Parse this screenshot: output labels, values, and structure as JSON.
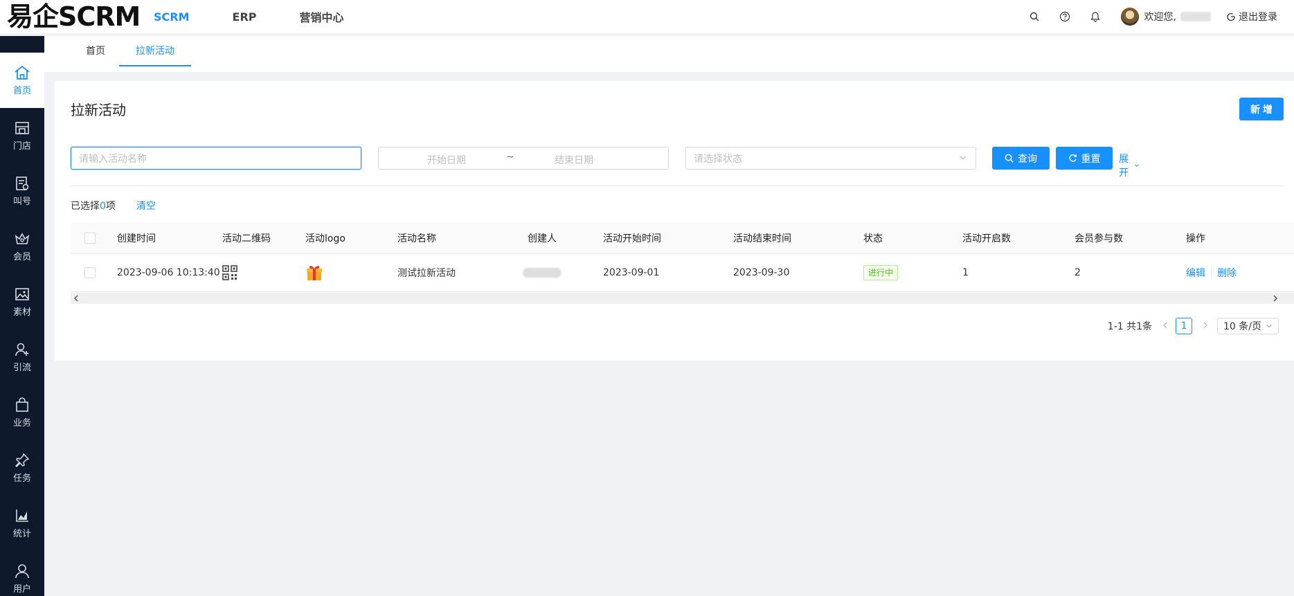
{
  "app": {
    "logo": "易企SCRM"
  },
  "topnav": {
    "items": [
      "SCRM",
      "ERP",
      "营销中心"
    ],
    "active": "SCRM"
  },
  "header": {
    "welcome": "欢迎您,",
    "logout": "退出登录"
  },
  "sidebar": {
    "items": [
      {
        "label": "首页",
        "icon": "home-icon"
      },
      {
        "label": "门店",
        "icon": "store-icon"
      },
      {
        "label": "叫号",
        "icon": "queue-icon"
      },
      {
        "label": "会员",
        "icon": "member-icon"
      },
      {
        "label": "素材",
        "icon": "image-icon"
      },
      {
        "label": "引流",
        "icon": "user-add-icon"
      },
      {
        "label": "业务",
        "icon": "bag-icon"
      },
      {
        "label": "任务",
        "icon": "pin-icon"
      },
      {
        "label": "统计",
        "icon": "chart-icon"
      },
      {
        "label": "用户",
        "icon": "user-icon"
      }
    ]
  },
  "tabs": [
    "首页",
    "拉新活动"
  ],
  "page": {
    "title": "拉新活动",
    "new_label": "新 增"
  },
  "filters": {
    "name_placeholder": "请输入活动名称",
    "start_placeholder": "开始日期",
    "date_sep": "~",
    "end_placeholder": "结束日期",
    "status_placeholder": "请选择状态",
    "query_label": "查询",
    "reset_label": "重置",
    "expand_label": "展开"
  },
  "selection": {
    "prefix": "已选择",
    "count": "0",
    "suffix": "项",
    "clear_label": "清空"
  },
  "table": {
    "headers": [
      "创建时间",
      "活动二维码",
      "活动logo",
      "活动名称",
      "创建人",
      "活动开始时间",
      "活动结束时间",
      "状态",
      "活动开启数",
      "会员参与数",
      "操作"
    ],
    "rows": [
      {
        "created": "2023-09-06 10:13:40",
        "name": "测试拉新活动",
        "start": "2023-09-01",
        "end": "2023-09-30",
        "status": "进行中",
        "open_count": "1",
        "member_count": "2",
        "edit": "编辑",
        "delete": "删除"
      }
    ]
  },
  "pagination": {
    "summary": "1-1 共1条",
    "current": "1",
    "page_size": "10 条/页"
  },
  "colors": {
    "primary": "#1890ff",
    "sidebar_bg": "#0e1a2b",
    "success": "#52c41a"
  }
}
